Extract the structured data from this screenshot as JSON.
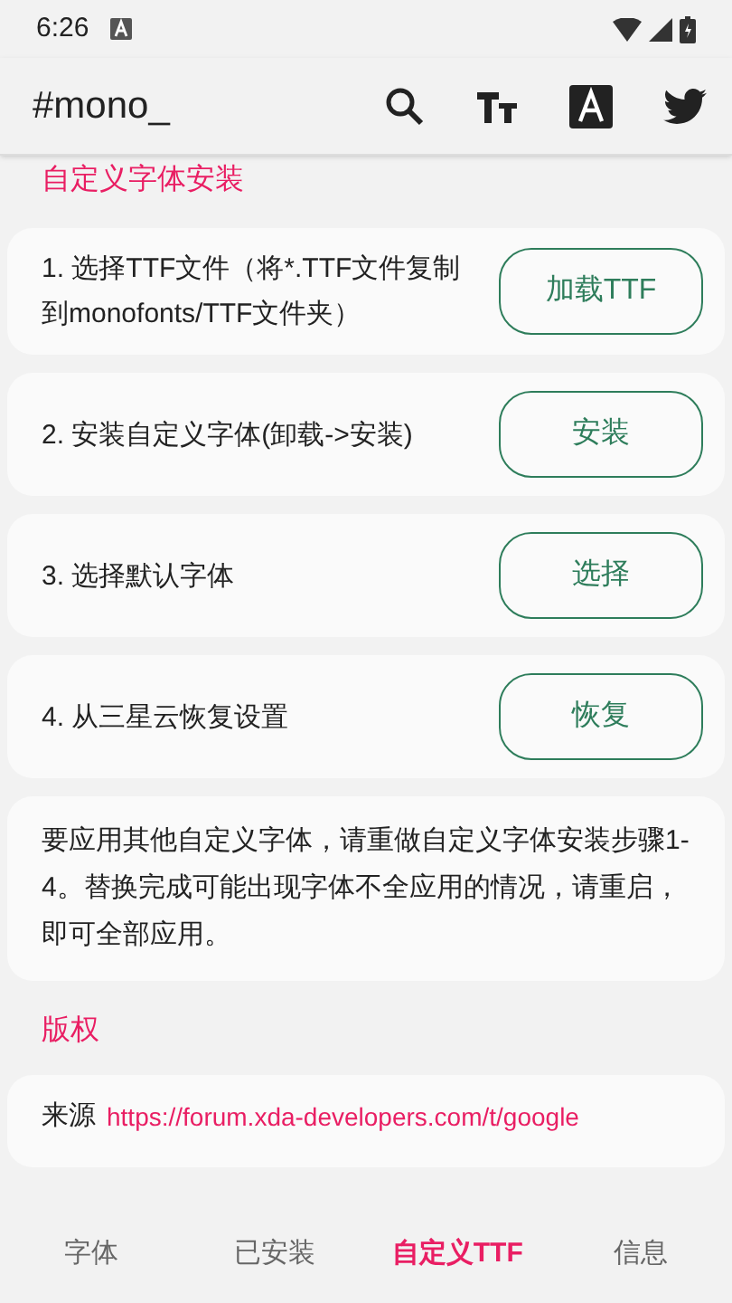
{
  "status_bar": {
    "time": "6:26"
  },
  "app_bar": {
    "title": "#mono_"
  },
  "section_install": {
    "title": "自定义字体安装",
    "steps": [
      {
        "text": "1. 选择TTF文件（将*.TTF文件复制到monofonts/TTF文件夹）",
        "button": "加载TTF"
      },
      {
        "text": "2. 安装自定义字体(卸载->安装)",
        "button": "安装"
      },
      {
        "text": "3. 选择默认字体",
        "button": "选择"
      },
      {
        "text": "4. 从三星云恢复设置",
        "button": "恢复"
      }
    ],
    "note": "要应用其他自定义字体，请重做自定义字体安装步骤1-4。替换完成可能出现字体不全应用的情况，请重启，即可全部应用。"
  },
  "section_copyright": {
    "title": "版权",
    "source_label": "来源",
    "source_link": "https://forum.xda-developers.com/t/google"
  },
  "bottom_nav": [
    {
      "label": "字体",
      "selected": false
    },
    {
      "label": "已安装",
      "selected": false
    },
    {
      "label": "自定义TTF",
      "selected": true
    },
    {
      "label": "信息",
      "selected": false
    }
  ]
}
